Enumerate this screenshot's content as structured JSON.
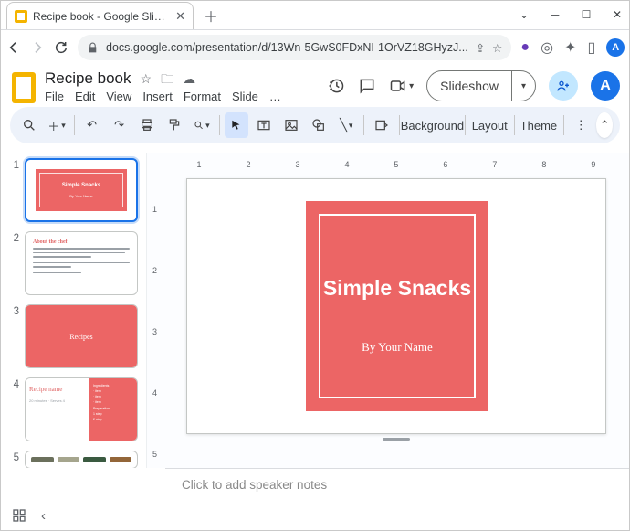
{
  "browser": {
    "tab_title": "Recipe book - Google Slides",
    "url": "docs.google.com/presentation/d/13Wn-5GwS0FDxNI-1OrVZ18GHyzJ...",
    "avatar_letter": "A"
  },
  "doc": {
    "title": "Recipe book",
    "menus": [
      "File",
      "Edit",
      "View",
      "Insert",
      "Format",
      "Slide",
      "…"
    ],
    "slideshow_label": "Slideshow",
    "avatar_letter": "A"
  },
  "toolbar": {
    "background": "Background",
    "layout": "Layout",
    "theme": "Theme"
  },
  "ruler_h": [
    "",
    "1",
    "",
    "2",
    "",
    "3",
    "",
    "4",
    "",
    "5",
    "",
    "6",
    "",
    "7",
    "",
    "8",
    "",
    "9",
    ""
  ],
  "ruler_v": [
    "",
    "1",
    "",
    "2",
    "",
    "3",
    "",
    "4",
    "",
    "5"
  ],
  "thumbs": {
    "t1_title": "Simple Snacks",
    "t1_by": "By Your Name",
    "t2_title": "About the chef",
    "t3_title": "Recipes",
    "t4_title": "Recipe name",
    "t4_sub": "20 minutes · Serves 4",
    "t4_ing": "Ingredients",
    "t4_prep": "Preparation"
  },
  "slide": {
    "title": "Simple Snacks",
    "byline": "By Your Name"
  },
  "notes": {
    "placeholder": "Click to add speaker notes"
  },
  "colors": {
    "accent": "#ec6565"
  }
}
